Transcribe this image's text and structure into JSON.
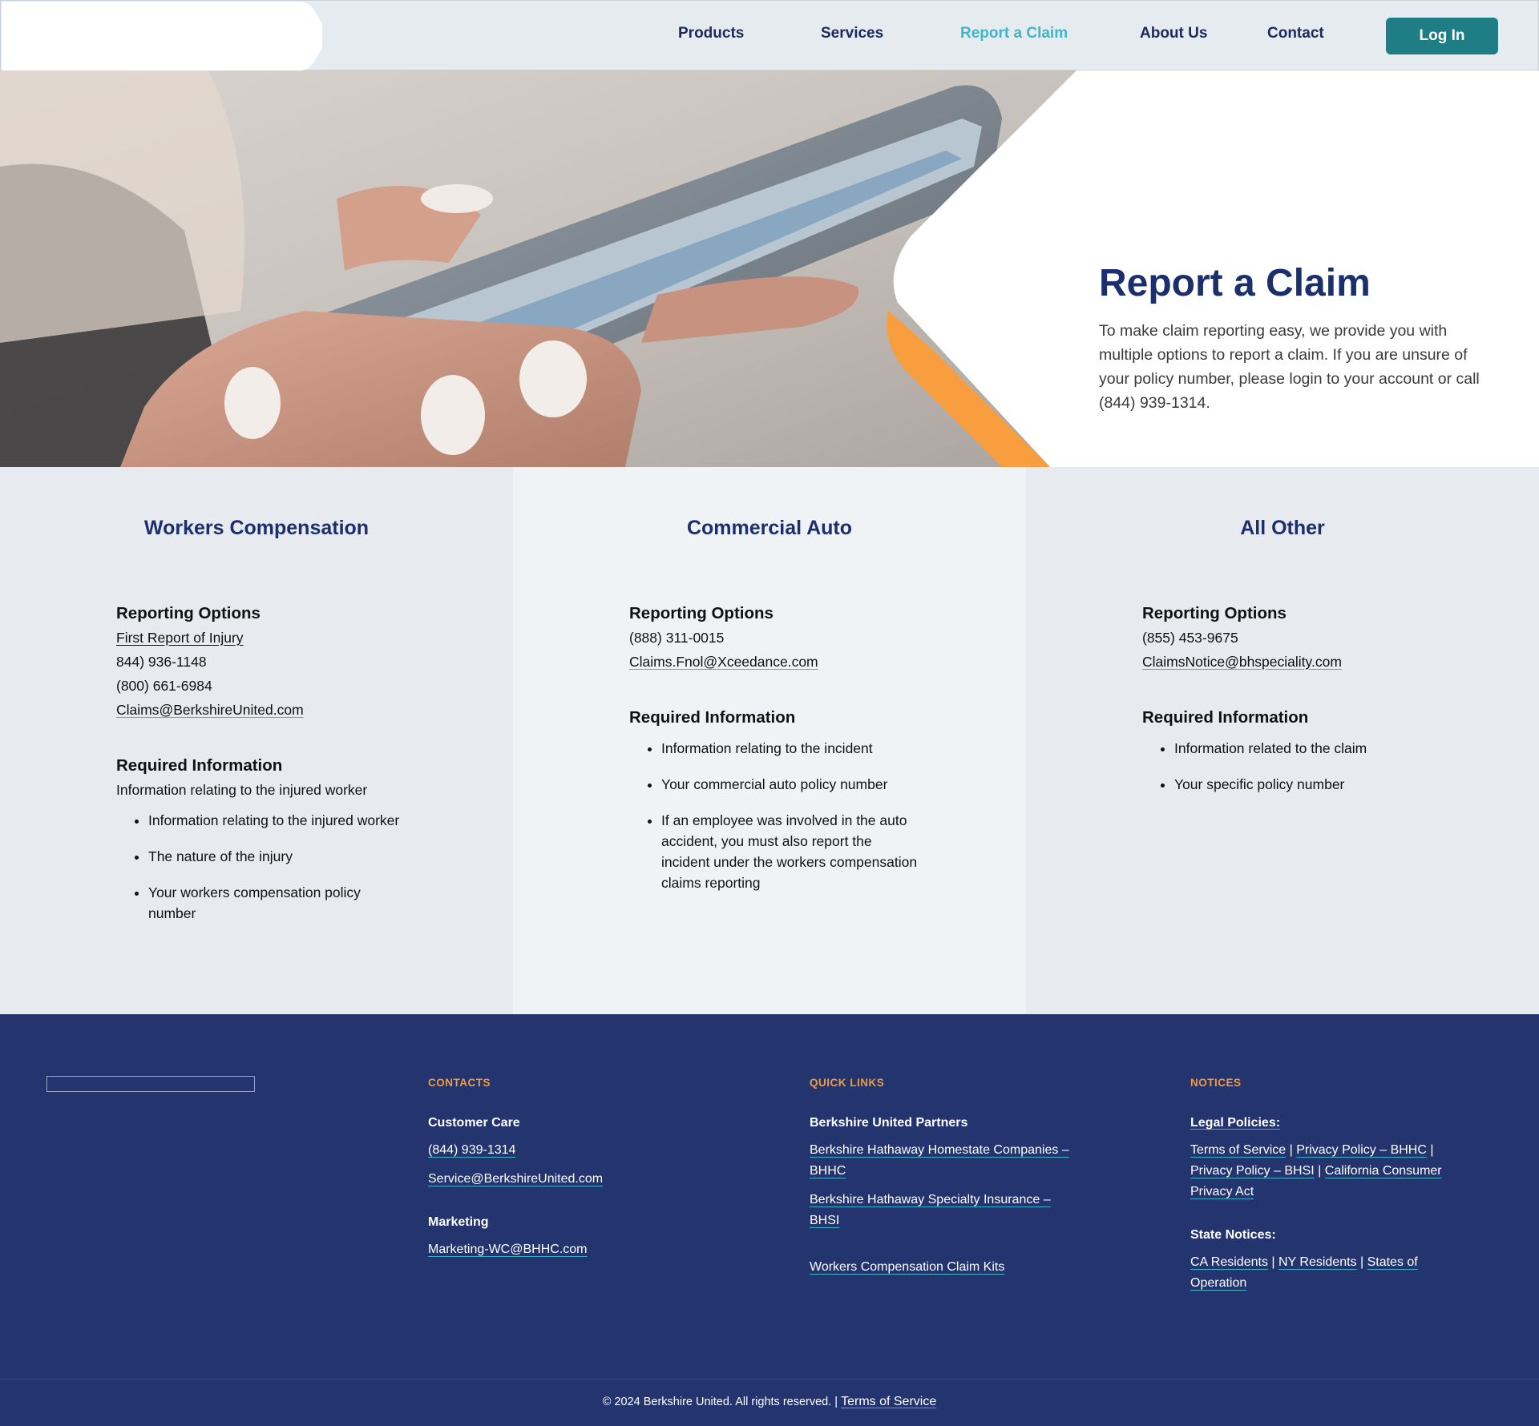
{
  "nav": {
    "items": [
      {
        "label": "Products"
      },
      {
        "label": "Services"
      },
      {
        "label": "Report a Claim"
      },
      {
        "label": "About Us"
      },
      {
        "label": "Contact"
      }
    ],
    "login_label": "Log In",
    "active_color": "#3eb6c9"
  },
  "hero": {
    "title": "Report a Claim",
    "text": "To make claim reporting easy, we provide you with multiple options to report a claim. If you are unsure of your policy number, please login to your account or call (844) 939-1314.",
    "accent_color": "#f99e3e"
  },
  "columns": [
    {
      "title": "Workers Compensation",
      "reporting_heading": "Reporting Options",
      "reporting": [
        "First Report of Injury",
        "844) 936-1148",
        "(800) 661-6984",
        "Claims@BerkshireUnited.com"
      ],
      "required_heading": "Required Information",
      "required_intro": "Information relating to the injured worker",
      "required_items": [
        "Information relating to the injured worker",
        "The nature of the injury",
        "Your workers compensation policy number"
      ]
    },
    {
      "title": "Commercial Auto",
      "reporting_heading": "Reporting Options",
      "reporting": [
        "(888) 311-0015",
        "Claims.Fnol@Xceedance.com"
      ],
      "required_heading": "Required Information",
      "required_items": [
        "Information relating to the incident",
        "Your commercial auto policy number",
        "If an employee was involved in the auto accident, you must also report the incident under the workers compensation claims reporting"
      ]
    },
    {
      "title": "All Other",
      "reporting_heading": "Reporting Options",
      "reporting": [
        "(855) 453-9675",
        "ClaimsNotice@bhspeciality.com"
      ],
      "required_heading": "Required Information",
      "required_items": [
        "Information related to the claim",
        "Your specific policy number"
      ]
    }
  ],
  "footer": {
    "contacts": {
      "heading": "CONTACTS",
      "customer_care": "Customer Care",
      "phone": "(844) 939-1314",
      "email": "Service@BerkshireUnited.com",
      "marketing": "Marketing",
      "marketing_email": "Marketing-WC@BHHC.com"
    },
    "quick_links": {
      "heading": "QUICK LINKS",
      "partners": "Berkshire United Partners",
      "link1": "Berkshire Hathaway Homestate Companies – BHHC",
      "link2": "Berkshire Hathaway Specialty Insurance – BHSI",
      "link3": "Workers Compensation Claim Kits"
    },
    "notices": {
      "heading": "NOTICES",
      "legal": "Legal Policies:",
      "terms": "Terms of Service",
      "privacy_bhhc": "Privacy Policy – BHHC",
      "privacy_bhsi": "Privacy Policy – BHSI",
      "ccpa": "California Consumer Privacy Act",
      "state": "State Notices:",
      "ca": "CA Residents",
      "ny": "NY Residents",
      "states": "States of Operation",
      "sep": "|"
    },
    "copyright": "© 2024 Berkshire United. All rights reserved. |",
    "bottom_terms": "Terms of Service",
    "heading_color": "#f19a3e",
    "background": "#23346e"
  }
}
